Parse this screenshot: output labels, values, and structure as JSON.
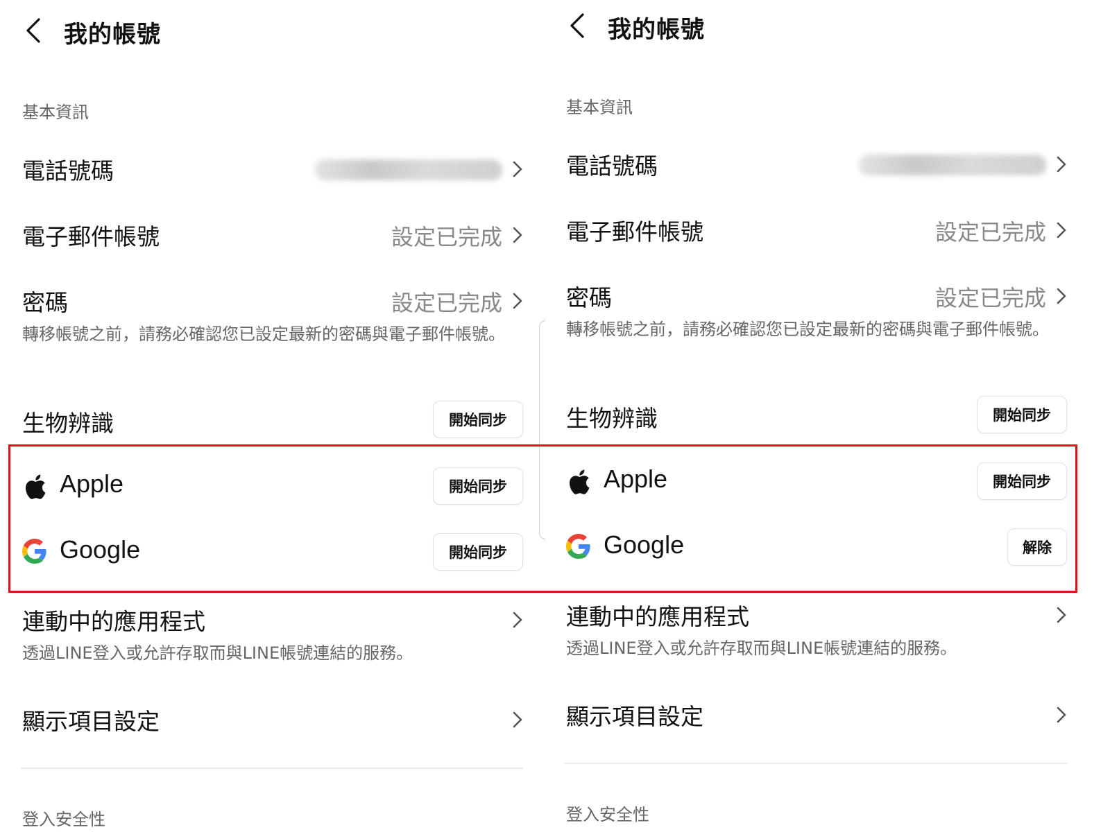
{
  "colors": {
    "highlight": "#d9121b",
    "secondary_text": "#888888",
    "google_blue": "#4285F4",
    "google_red": "#EA4335",
    "google_yellow": "#FBBC05",
    "google_green": "#34A853"
  },
  "panels": [
    {
      "header": {
        "title": "我的帳號",
        "back_icon": "chevron-left-icon"
      },
      "section_basic": "基本資訊",
      "phone": {
        "label": "電話號碼",
        "value_blurred": true
      },
      "email": {
        "label": "電子郵件帳號",
        "value": "設定已完成"
      },
      "password": {
        "label": "密碼",
        "value": "設定已完成"
      },
      "password_note": "轉移帳號之前，請務必確認您已設定最新的密碼與電子郵件帳號。",
      "biometric": {
        "label": "生物辨識",
        "button": "開始同步"
      },
      "apple": {
        "label": "Apple",
        "button": "開始同步",
        "icon": "apple-icon"
      },
      "google": {
        "label": "Google",
        "button": "開始同步",
        "icon": "google-icon"
      },
      "linked_apps": {
        "label": "連動中的應用程式",
        "note": "透過LINE登入或允許存取而與LINE帳號連結的服務。"
      },
      "display_items": {
        "label": "顯示項目設定"
      },
      "section_security": "登入安全性"
    },
    {
      "header": {
        "title": "我的帳號",
        "back_icon": "chevron-left-icon"
      },
      "section_basic": "基本資訊",
      "phone": {
        "label": "電話號碼",
        "value_blurred": true
      },
      "email": {
        "label": "電子郵件帳號",
        "value": "設定已完成"
      },
      "password": {
        "label": "密碼",
        "value": "設定已完成"
      },
      "password_note": "轉移帳號之前，請務必確認您已設定最新的密碼與電子郵件帳號。",
      "biometric": {
        "label": "生物辨識",
        "button": "開始同步"
      },
      "apple": {
        "label": "Apple",
        "button": "開始同步",
        "icon": "apple-icon"
      },
      "google": {
        "label": "Google",
        "button": "解除",
        "icon": "google-icon"
      },
      "linked_apps": {
        "label": "連動中的應用程式",
        "note": "透過LINE登入或允許存取而與LINE帳號連結的服務。"
      },
      "display_items": {
        "label": "顯示項目設定"
      },
      "section_security": "登入安全性"
    }
  ]
}
